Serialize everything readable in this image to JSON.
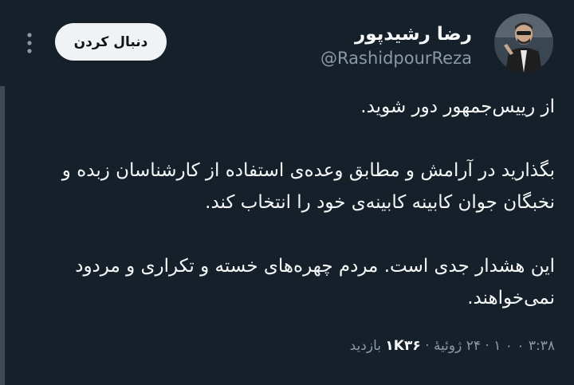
{
  "tweet": {
    "author": {
      "display_name": "رضا رشیدپور",
      "handle": "@RashidpourReza"
    },
    "follow_label": "دنبال کردن",
    "paragraphs": [
      [
        "از رییس‌جمهور دور شوید."
      ],
      [
        "بگذارید در آرامش و مطابق وعده‌ی استفاده از کارشناسان زبده و",
        "نخبگان جوان کابینه کابینه‌ی خود را انتخاب کند."
      ],
      [
        "این هشدار جدی است. مردم چهره‌های خسته و تکراری و مردود",
        "نمی‌خواهند."
      ]
    ],
    "meta": {
      "time": "۳:۳۸ ۰ ۰ ۱",
      "date": "۲۴ ژوئیهٔ",
      "views": "۱K۳۶",
      "views_label": "بازدید",
      "separator": "·"
    }
  },
  "icons": {
    "more": "more-vertical-icon",
    "avatar": "profile-photo"
  },
  "colors": {
    "background": "#15202b",
    "text": "#f7f9f9",
    "secondary": "#8b98a5",
    "button_bg": "#eff3f4",
    "button_text": "#0f1419"
  }
}
